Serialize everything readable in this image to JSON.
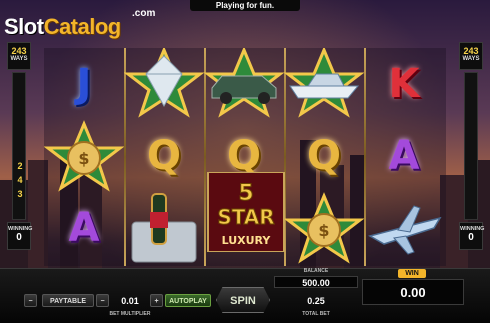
{
  "logo": {
    "part1": "Slot",
    "part2": "Catalog",
    "suffix": ".com"
  },
  "status_message": "Playing for fun.",
  "ways_panel": {
    "left": {
      "ways_value": "243",
      "ways_label": "WAYS",
      "digits": [
        "2",
        "4",
        "3"
      ],
      "winning_label": "WINNING",
      "winning_value": "0"
    },
    "right": {
      "ways_value": "243",
      "ways_label": "WAYS",
      "winning_label": "WINNING",
      "winning_value": "0"
    }
  },
  "reels": {
    "icons": [
      [
        "letter-j",
        "diamond",
        "money-bag-star"
      ],
      [
        "diamond-star",
        "letter-q",
        "champagne"
      ],
      [
        "luxury-car",
        "letter-q",
        "five-star-luxury"
      ],
      [
        "yacht-star",
        "letter-q",
        "money-bag-star"
      ],
      [
        "letter-k",
        "letter-a",
        "private-jet"
      ],
      [
        "letter-a-dummy",
        "letter-a-dummy",
        "letter-a-dummy"
      ]
    ],
    "letters": {
      "j": "J",
      "q": "Q",
      "k": "K",
      "a": "A"
    },
    "five_star": {
      "number": "5",
      "word": "STAR",
      "luxury": "LUXURY"
    }
  },
  "controls": {
    "paytable_label": "PAYTABLE",
    "autoplay_label": "AUTOPLAY",
    "spin_label": "SPIN",
    "minus_symbol": "−",
    "plus_symbol": "+",
    "bet_multiplier_value": "0.01",
    "bet_multiplier_label": "BET MULTIPLIER",
    "balance_label": "BALANCE",
    "balance_value": "500.00",
    "total_bet_value": "0.25",
    "total_bet_label": "TOTAL BET",
    "win_label": "WIN",
    "win_value": "0.00"
  },
  "colors": {
    "gold": "#f3b52a",
    "autoplay_green": "#3a6a2a",
    "letter_blue": "#2a4fd8",
    "letter_red": "#e0303a",
    "letter_purple": "#a34adb"
  }
}
